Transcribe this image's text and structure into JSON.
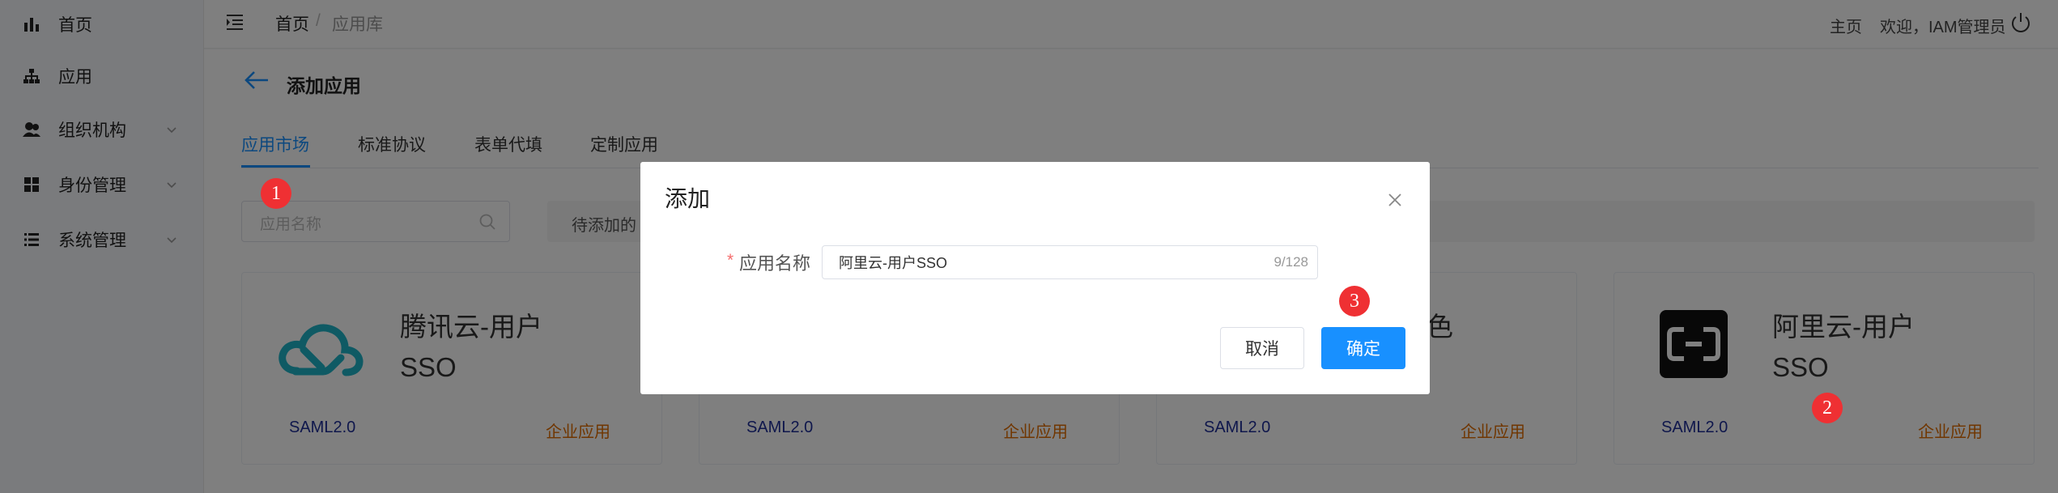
{
  "sidebar": {
    "items": [
      {
        "label": "首页",
        "icon": "bar-chart-icon"
      },
      {
        "label": "应用",
        "icon": "sitemap-icon"
      },
      {
        "label": "组织机构",
        "icon": "user-group-icon"
      },
      {
        "label": "身份管理",
        "icon": "grid-icon"
      },
      {
        "label": "系统管理",
        "icon": "list-icon"
      }
    ]
  },
  "header": {
    "breadcrumb": {
      "home": "首页",
      "sep": "/",
      "current": "应用库"
    },
    "home_link": "主页",
    "welcome": "欢迎，IAM管理员"
  },
  "page": {
    "title": "添加应用",
    "tabs": [
      "应用市场",
      "标准协议",
      "表单代填",
      "定制应用"
    ],
    "search_placeholder": "应用名称",
    "pending_label": "待添加的"
  },
  "cards": [
    {
      "name_line1": "腾讯云-用户",
      "name_line2": "SSO",
      "protocol": "SAML2.0",
      "type": "企业应用"
    },
    {
      "name_line1": "",
      "name_line2": "",
      "protocol": "SAML2.0",
      "type": "企业应用"
    },
    {
      "name_line1": "色",
      "name_line2": "",
      "protocol": "SAML2.0",
      "type": "企业应用"
    },
    {
      "name_line1": "阿里云-用户",
      "name_line2": "SSO",
      "protocol": "SAML2.0",
      "type": "企业应用"
    }
  ],
  "dialog": {
    "title": "添加",
    "required_mark": "*",
    "field_label": "应用名称",
    "field_value": "阿里云-用户SSO",
    "char_count": "9/128",
    "cancel_label": "取消",
    "ok_label": "确定"
  },
  "markers": [
    "1",
    "2",
    "3"
  ],
  "colors": {
    "accent": "#1890ff",
    "marker": "#ef3033",
    "protocol": "#1f2f98",
    "type": "#e06c00",
    "tencent": "#1fb4c8"
  }
}
